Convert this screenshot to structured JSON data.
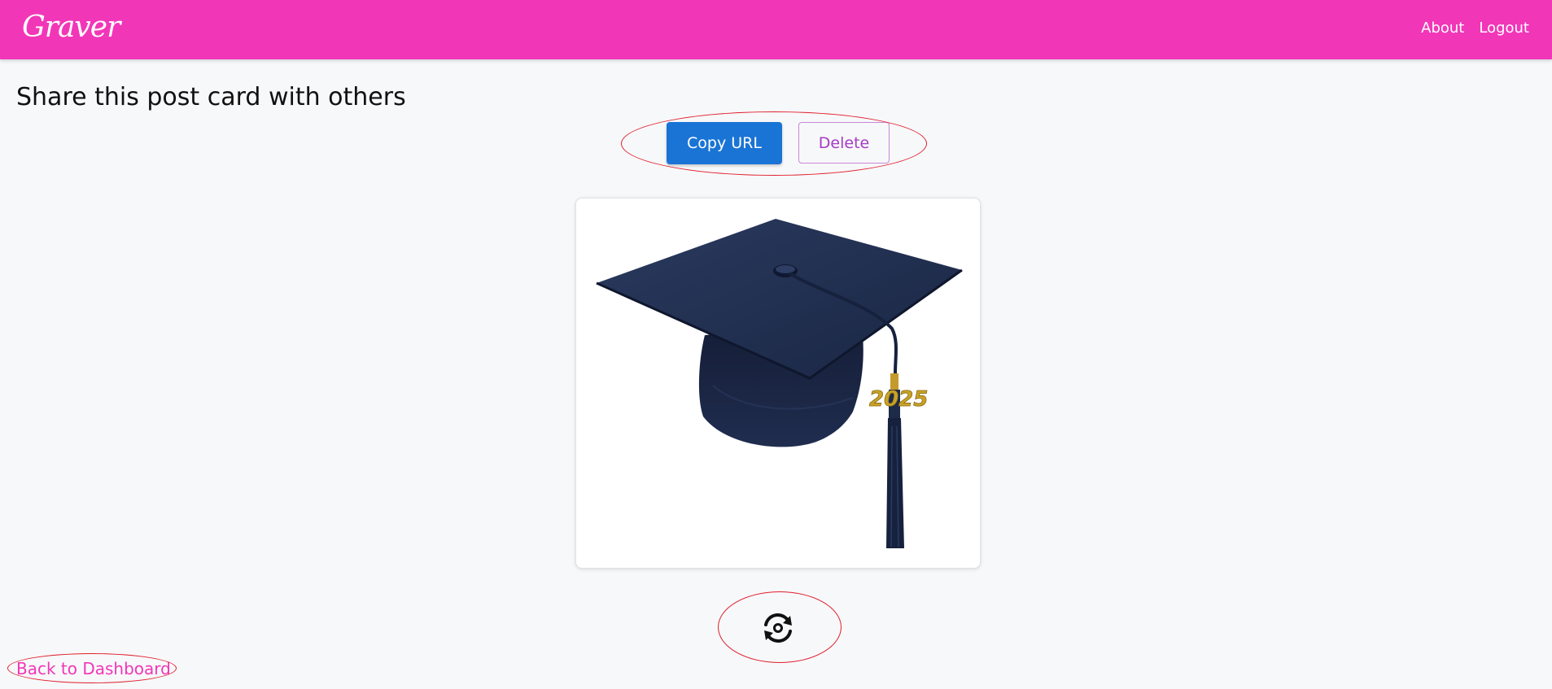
{
  "navbar": {
    "brand": "Graver",
    "links": [
      {
        "label": "About"
      },
      {
        "label": "Logout"
      }
    ],
    "color": "#f236b8"
  },
  "main": {
    "heading": "Share this post card with others",
    "copy_url_label": "Copy URL",
    "delete_label": "Delete",
    "card_image": {
      "subject": "graduation cap with tassel",
      "tassel_charm_text": "2025"
    },
    "rotate_icon": "rotate-icon",
    "back_link": "Back to Dashboard"
  },
  "colors": {
    "primary_button": "#1a74d6",
    "delete_text": "#a63bc4",
    "annotation": "#e01e2a",
    "cap": "#1d2a48"
  }
}
